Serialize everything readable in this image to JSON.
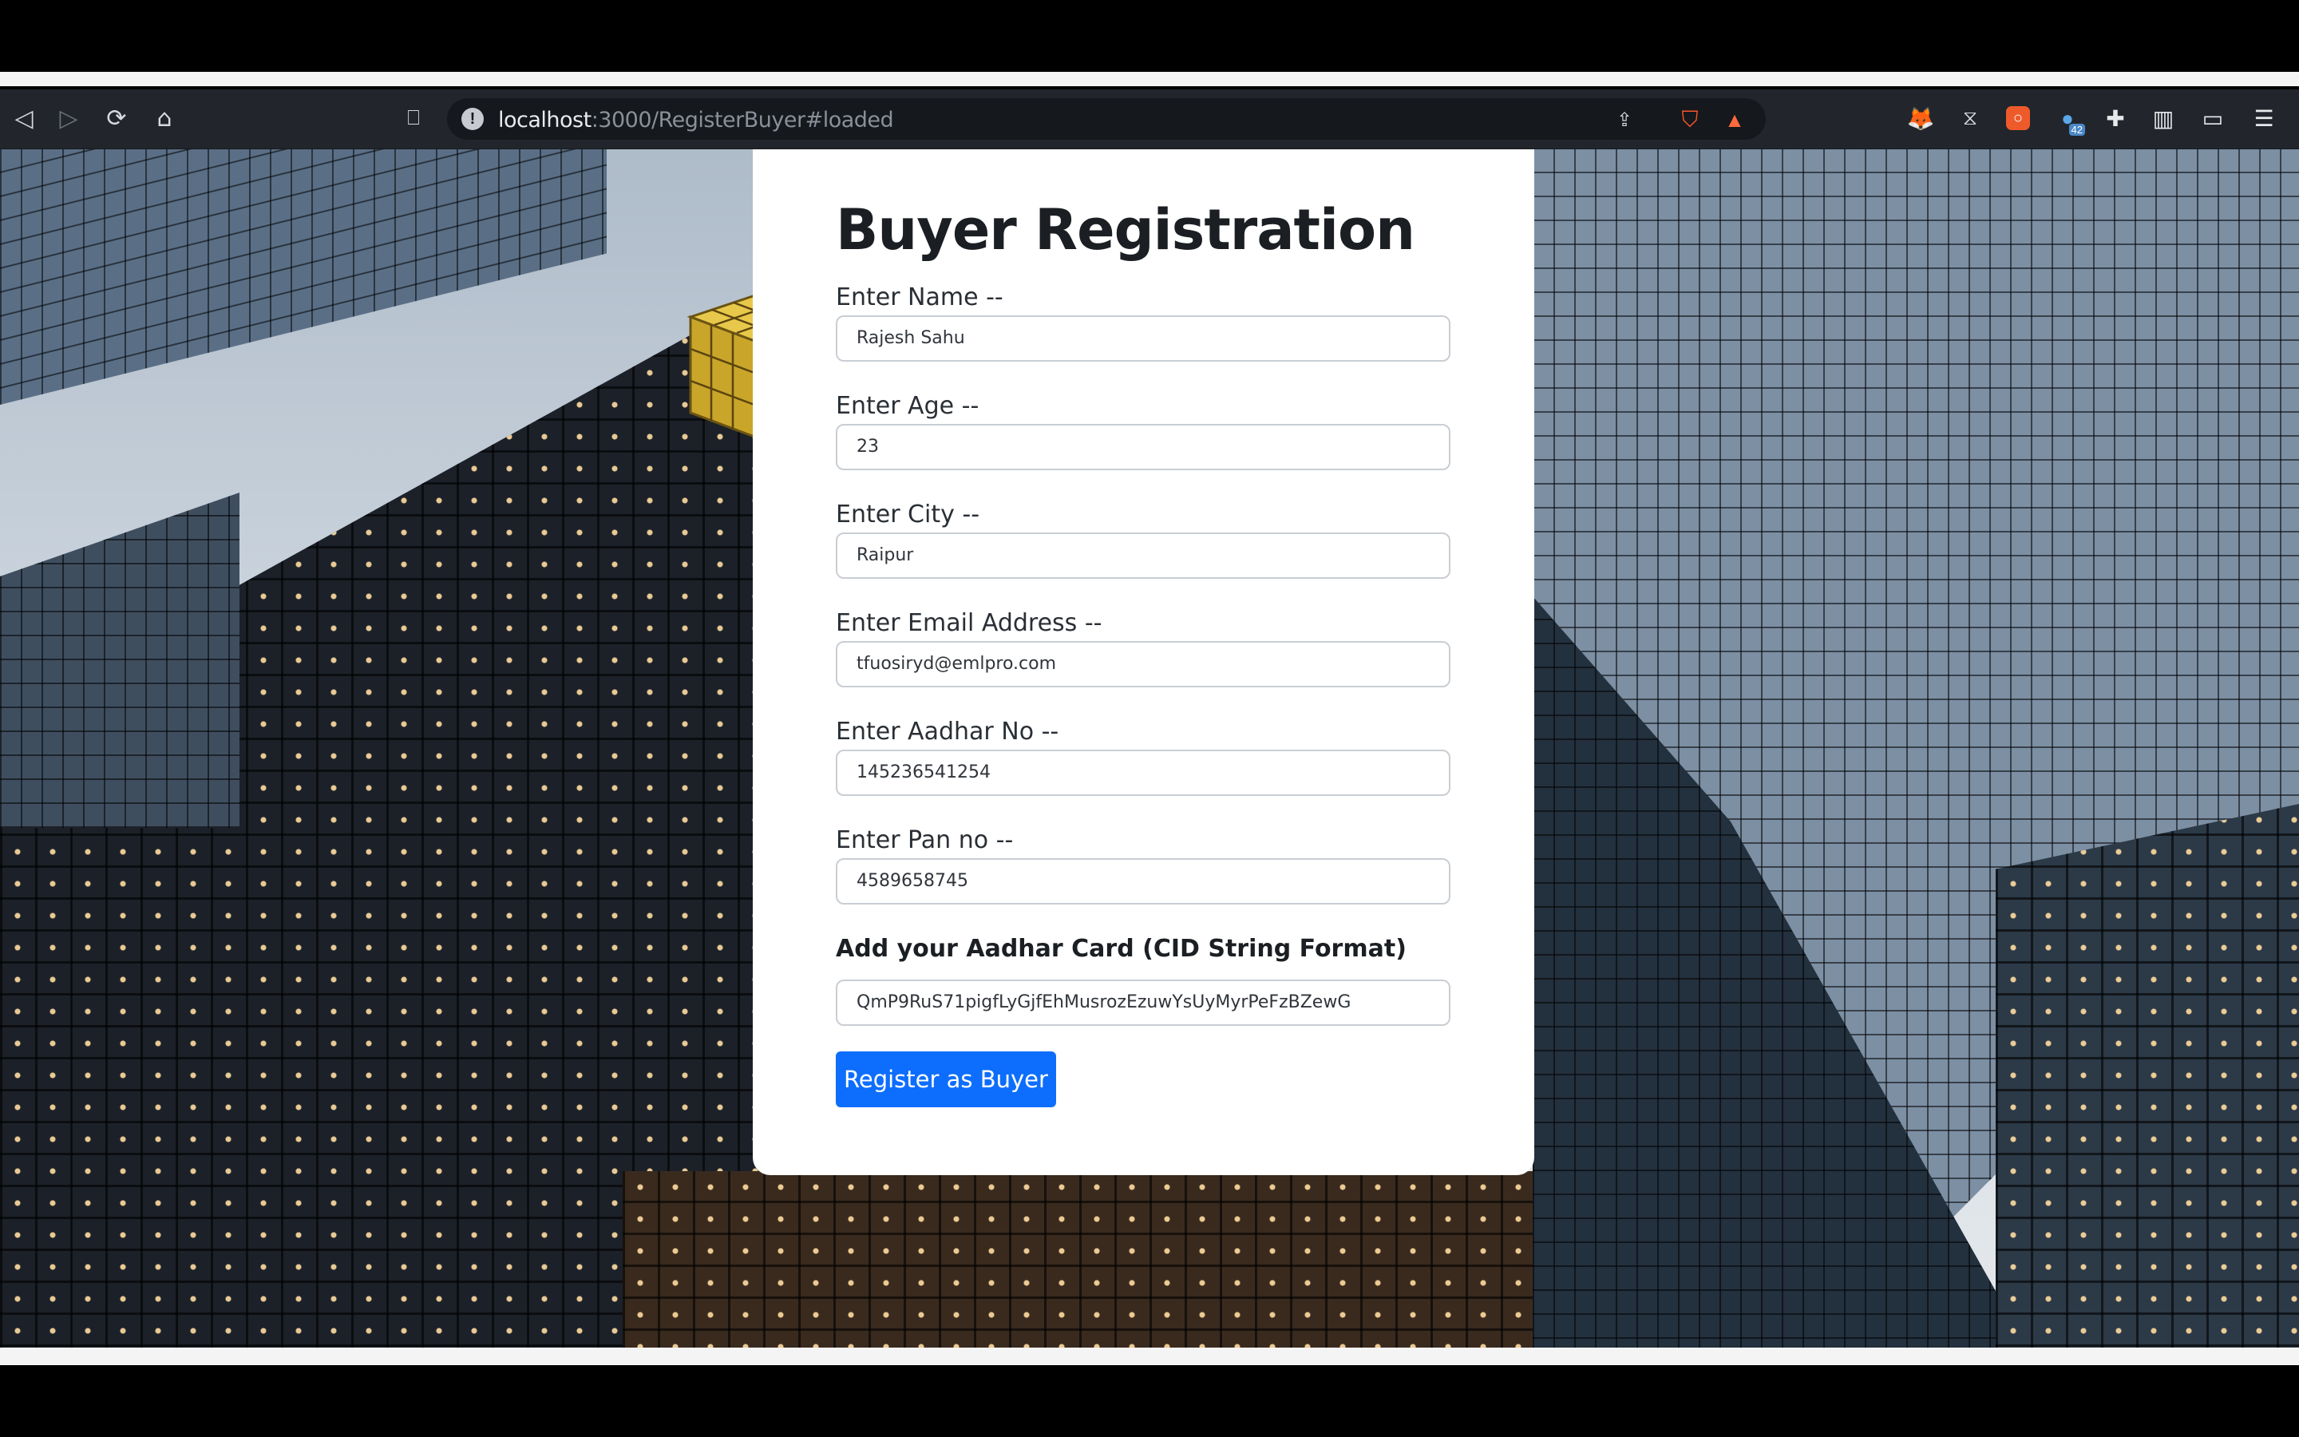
{
  "browser": {
    "url_host": "localhost",
    "url_path": ":3000/RegisterBuyer#loaded",
    "notification_badge": "42"
  },
  "form": {
    "title": "Buyer Registration",
    "fields": [
      {
        "label": "Enter Name --",
        "value": "Rajesh Sahu"
      },
      {
        "label": "Enter Age --",
        "value": "23"
      },
      {
        "label": "Enter City --",
        "value": "Raipur"
      },
      {
        "label": "Enter Email Address --",
        "value": "tfuosiryd@emlpro.com"
      },
      {
        "label": "Enter Aadhar No --",
        "value": "145236541254"
      },
      {
        "label": "Enter Pan no --",
        "value": "4589658745"
      }
    ],
    "aadhar_card_label": "Add your Aadhar Card (CID String Format)",
    "aadhar_card_value": "QmP9RuS71pigfLyGjfEhMusrozEzuwYsUyMyrPeFzBZewG",
    "submit_label": "Register as Buyer"
  },
  "colors": {
    "primary": "#0d6efd",
    "toolbar": "#22262c"
  }
}
